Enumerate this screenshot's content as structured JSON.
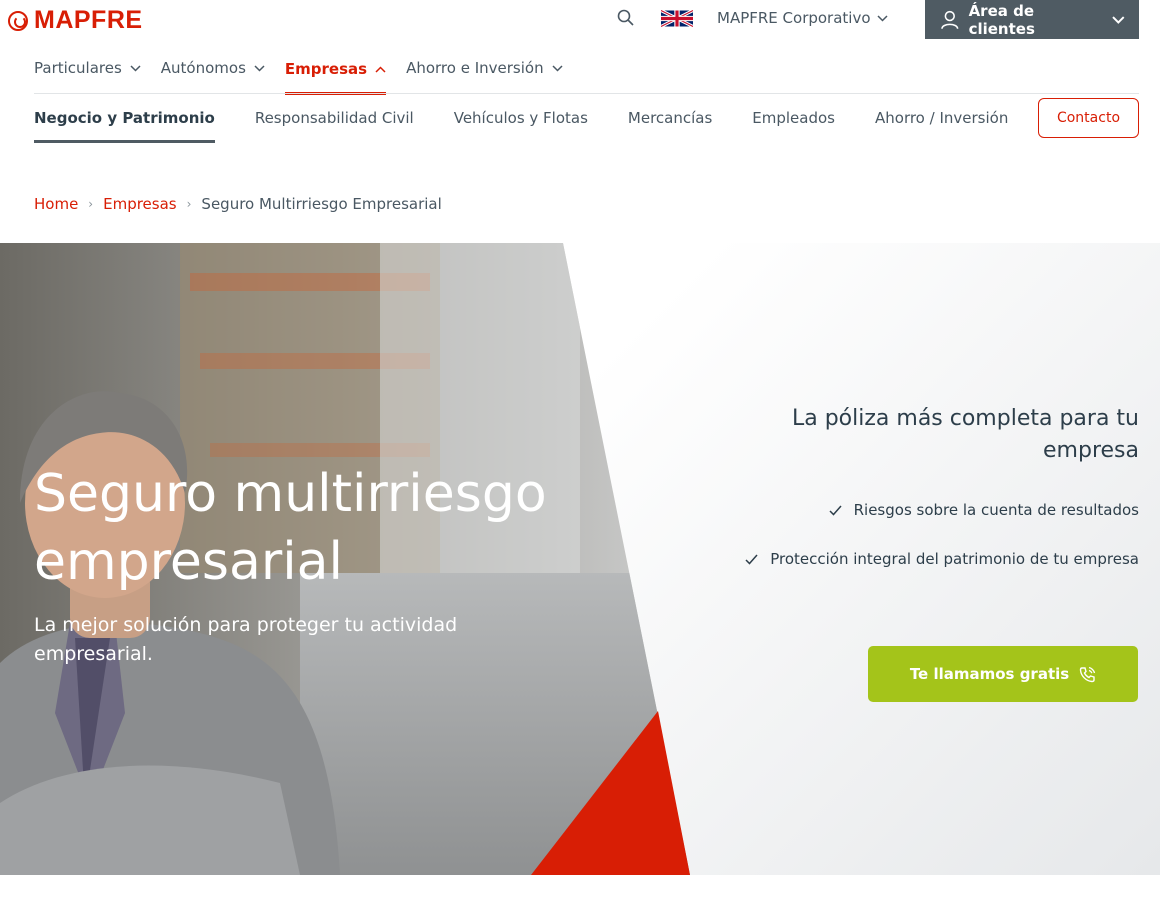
{
  "brand": {
    "name": "MAPFRE",
    "color": "#d81e05"
  },
  "topbar": {
    "search_icon": "search-icon",
    "language_flag": "uk-flag-icon",
    "corporate_label": "MAPFRE Corporativo",
    "clients_label": "Área de clientes"
  },
  "nav": {
    "items": [
      {
        "label": "Particulares"
      },
      {
        "label": "Autónomos"
      },
      {
        "label": "Empresas"
      },
      {
        "label": "Ahorro e Inversión"
      }
    ],
    "active_index": 2
  },
  "subnav": {
    "items": [
      {
        "label": "Negocio y Patrimonio"
      },
      {
        "label": "Responsabilidad Civil"
      },
      {
        "label": "Vehículos y Flotas"
      },
      {
        "label": "Mercancías"
      },
      {
        "label": "Empleados"
      },
      {
        "label": "Ahorro / Inversión"
      }
    ],
    "active_index": 0,
    "contact_label": "Contacto"
  },
  "breadcrumb": {
    "home": "Home",
    "section": "Empresas",
    "current": "Seguro Multirriesgo Empresarial"
  },
  "hero": {
    "title": "Seguro multirriesgo empresarial",
    "subtitle": "La mejor solución para proteger tu actividad empresarial.",
    "side_title": "La póliza más completa para tu empresa",
    "bullets": [
      "Riesgos sobre la cuenta de resultados",
      "Protección integral del patrimonio de tu empresa"
    ],
    "cta_label": "Te llamamos gratis",
    "cta_color": "#a4c41a"
  }
}
